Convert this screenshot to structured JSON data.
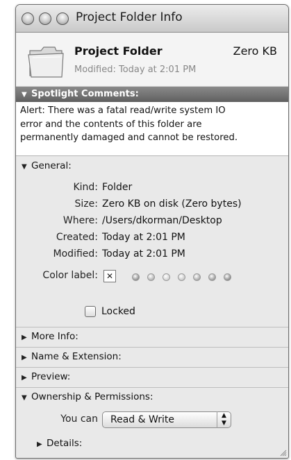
{
  "window": {
    "title": "Project Folder Info"
  },
  "header": {
    "name": "Project Folder",
    "size": "Zero KB",
    "modified": "Modified: Today at 2:01 PM"
  },
  "spotlight": {
    "label": "Spotlight Comments:",
    "lines": [
      "Alert: There was a fatal read/write system IO",
      "error and the contents of this folder are",
      "permanently damaged and cannot be restored."
    ]
  },
  "general": {
    "label": "General:",
    "rows": [
      {
        "label": "Kind:",
        "value": "Folder"
      },
      {
        "label": "Size:",
        "value": "Zero KB on disk (Zero bytes)"
      },
      {
        "label": "Where:",
        "value": "/Users/dkorman/Desktop"
      },
      {
        "label": "Created:",
        "value": "Today at 2:01 PM"
      },
      {
        "label": "Modified:",
        "value": "Today at 2:01 PM"
      }
    ],
    "color_label": "Color label:",
    "color_selected": "none",
    "color_none_glyph": "✕",
    "color_dots": [
      "#8f8f8f",
      "#b3b3b3",
      "#d2d2d2",
      "#c9c9c9",
      "#a9a9a9",
      "#9a9a9a",
      "#8c8c8c"
    ],
    "locked_label": "Locked",
    "locked_checked": false
  },
  "sections": {
    "more_info": "More Info:",
    "name_extension": "Name & Extension:",
    "preview": "Preview:",
    "ownership": "Ownership & Permissions:"
  },
  "ownership": {
    "you_can_label": "You can",
    "you_can_value": "Read & Write",
    "details_label": "Details:"
  },
  "glyphs": {
    "expanded": "▼",
    "collapsed": "▶",
    "popup_up": "▲",
    "popup_down": "▼"
  }
}
